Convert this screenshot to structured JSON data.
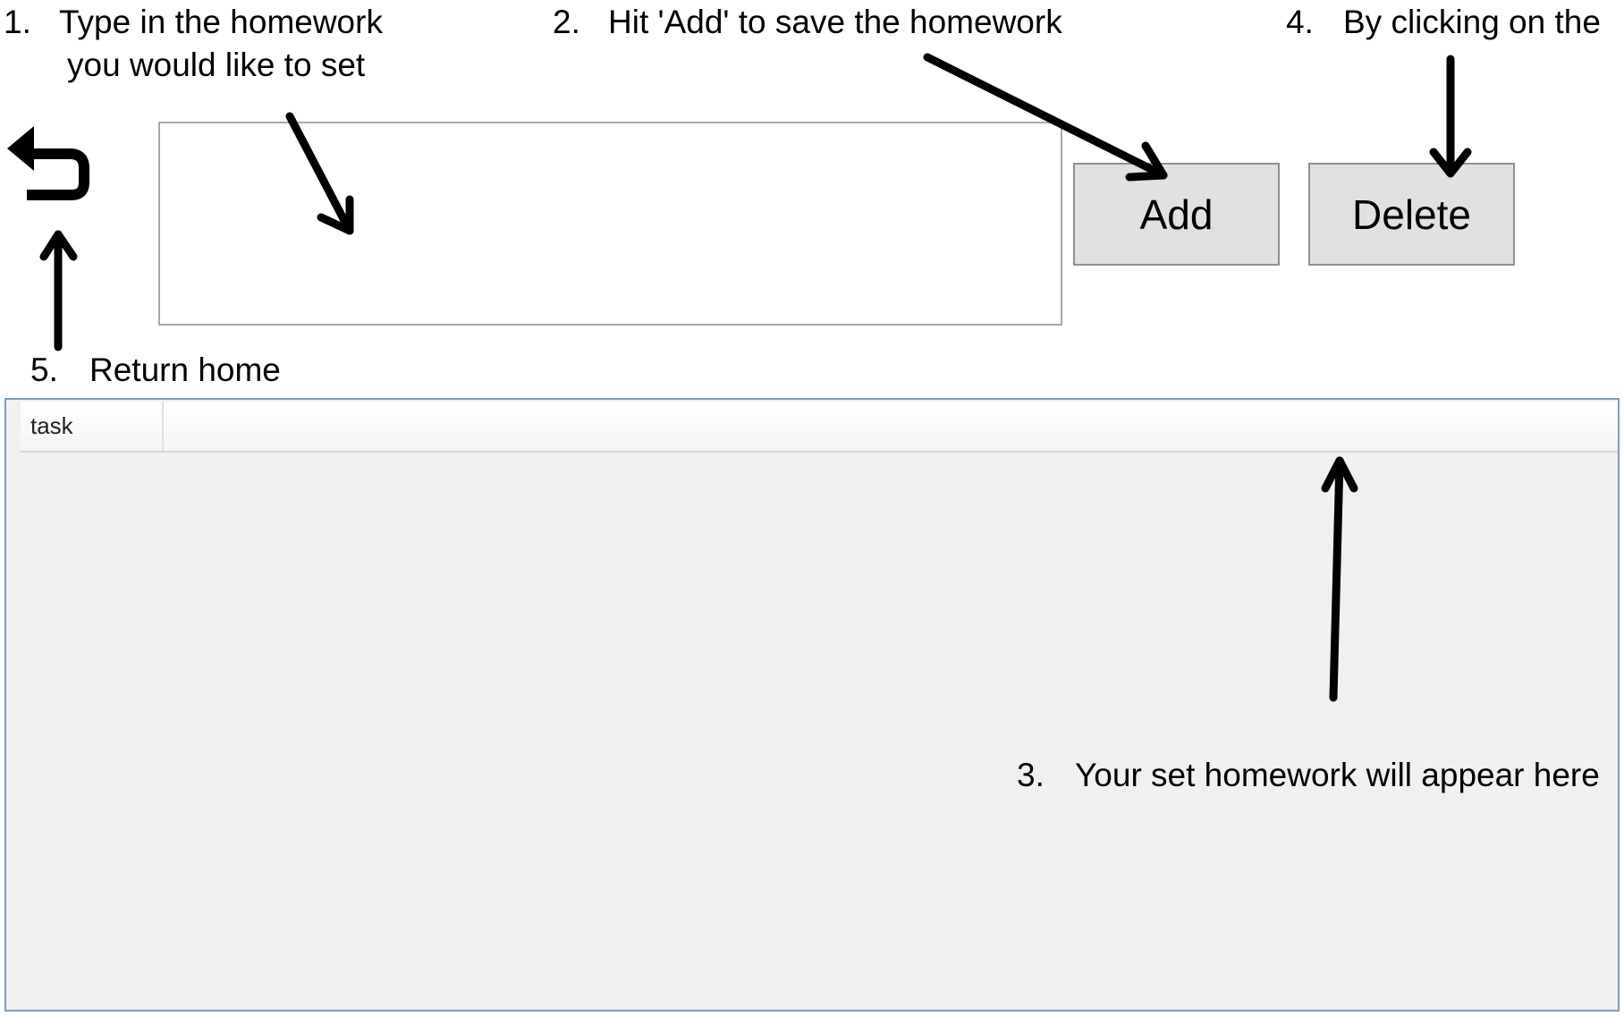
{
  "annotations": {
    "step1": {
      "num": "1.",
      "line1": "Type in the homework",
      "line2": "you would like to set"
    },
    "step2": {
      "num": "2.",
      "text": "Hit 'Add' to save the homework"
    },
    "step3": {
      "num": "3.",
      "text": "Your set homework will appear here"
    },
    "step4": {
      "num": "4.",
      "text": "By clicking on the"
    },
    "step5": {
      "num": "5.",
      "text": "Return home"
    }
  },
  "toolbar": {
    "back_icon": "return-arrow-icon",
    "homework_input_value": "",
    "add_label": "Add",
    "delete_label": "Delete"
  },
  "list": {
    "columns": [
      "task"
    ],
    "rows": []
  },
  "colors": {
    "button_bg": "#e1e1e1",
    "button_border": "#8f8f8f",
    "list_bg": "#f0f0f0",
    "list_border": "#7a9cc4",
    "input_border": "#a8a8a8"
  }
}
